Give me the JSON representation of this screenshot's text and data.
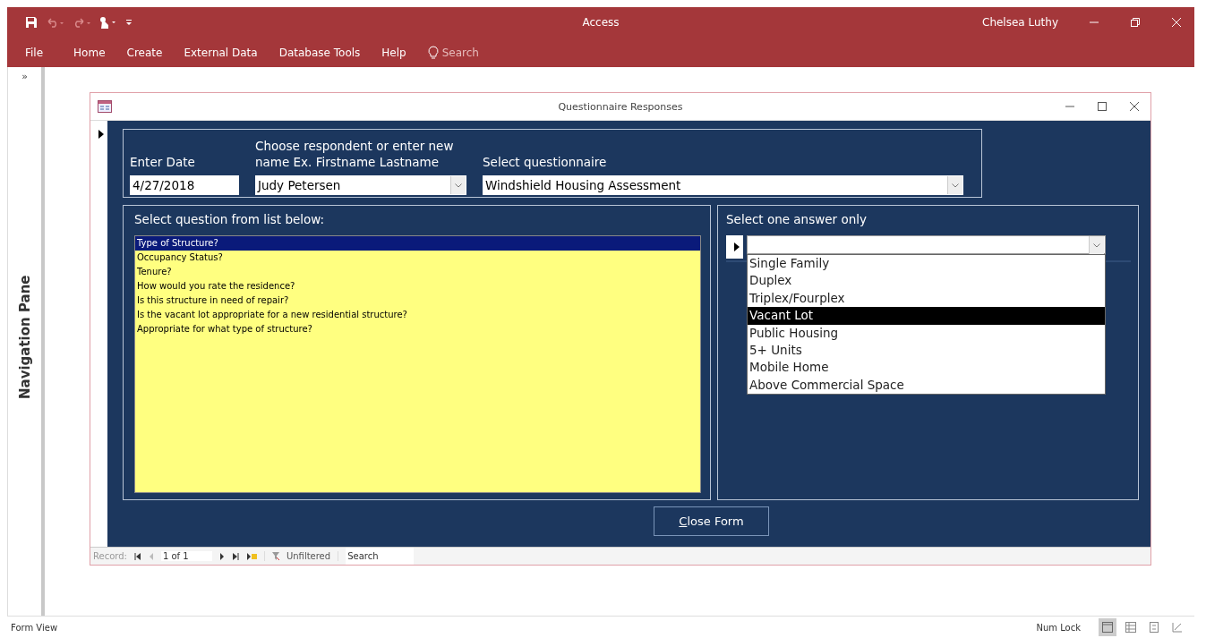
{
  "app": {
    "title": "Access",
    "user": "Chelsea Luthy"
  },
  "ribbon_tabs": [
    {
      "label": "File",
      "selected": false
    },
    {
      "label": "Home",
      "selected": false
    },
    {
      "label": "Create",
      "selected": false
    },
    {
      "label": "External Data",
      "selected": false
    },
    {
      "label": "Database Tools",
      "selected": false
    },
    {
      "label": "Help",
      "selected": false
    }
  ],
  "tell_me": {
    "placeholder": "Search"
  },
  "navigation_pane": {
    "toggle": "»",
    "label": "Navigation Pane"
  },
  "form": {
    "title": "Questionnaire Responses",
    "date": {
      "label": "Enter Date",
      "value": "4/27/2018"
    },
    "respondent": {
      "label": "Choose respondent or enter new name Ex. Firstname Lastname",
      "value": "Judy Petersen"
    },
    "questionnaire": {
      "label": "Select questionnaire",
      "value": "Windshield Housing Assessment"
    },
    "questions": {
      "label": "Select question from list below:",
      "items": [
        {
          "text": "Type of Structure?",
          "selected": true
        },
        {
          "text": "Occupancy Status?",
          "selected": false
        },
        {
          "text": "Tenure?",
          "selected": false
        },
        {
          "text": "How would you rate the residence?",
          "selected": false
        },
        {
          "text": "Is this structure in need of repair?",
          "selected": false
        },
        {
          "text": "Is the vacant lot appropriate for a new residential structure?",
          "selected": false
        },
        {
          "text": "Appropriate for what type of structure?",
          "selected": false
        }
      ]
    },
    "answers": {
      "label": "Select one answer only",
      "options": [
        {
          "text": "Single Family",
          "selected": false
        },
        {
          "text": "Duplex",
          "selected": false
        },
        {
          "text": "Triplex/Fourplex",
          "selected": false
        },
        {
          "text": "Vacant Lot",
          "selected": true
        },
        {
          "text": "Public Housing",
          "selected": false
        },
        {
          "text": "5+ Units",
          "selected": false
        },
        {
          "text": "Mobile Home",
          "selected": false
        },
        {
          "text": "Above Commercial Space",
          "selected": false
        }
      ]
    },
    "close_button": "Close Form",
    "record_nav": {
      "label": "Record:",
      "position": "1 of 1",
      "filter": "Unfiltered",
      "search": {
        "placeholder": "Search"
      }
    }
  },
  "status_bar": {
    "view": "Form View",
    "indicator": "Num Lock"
  }
}
